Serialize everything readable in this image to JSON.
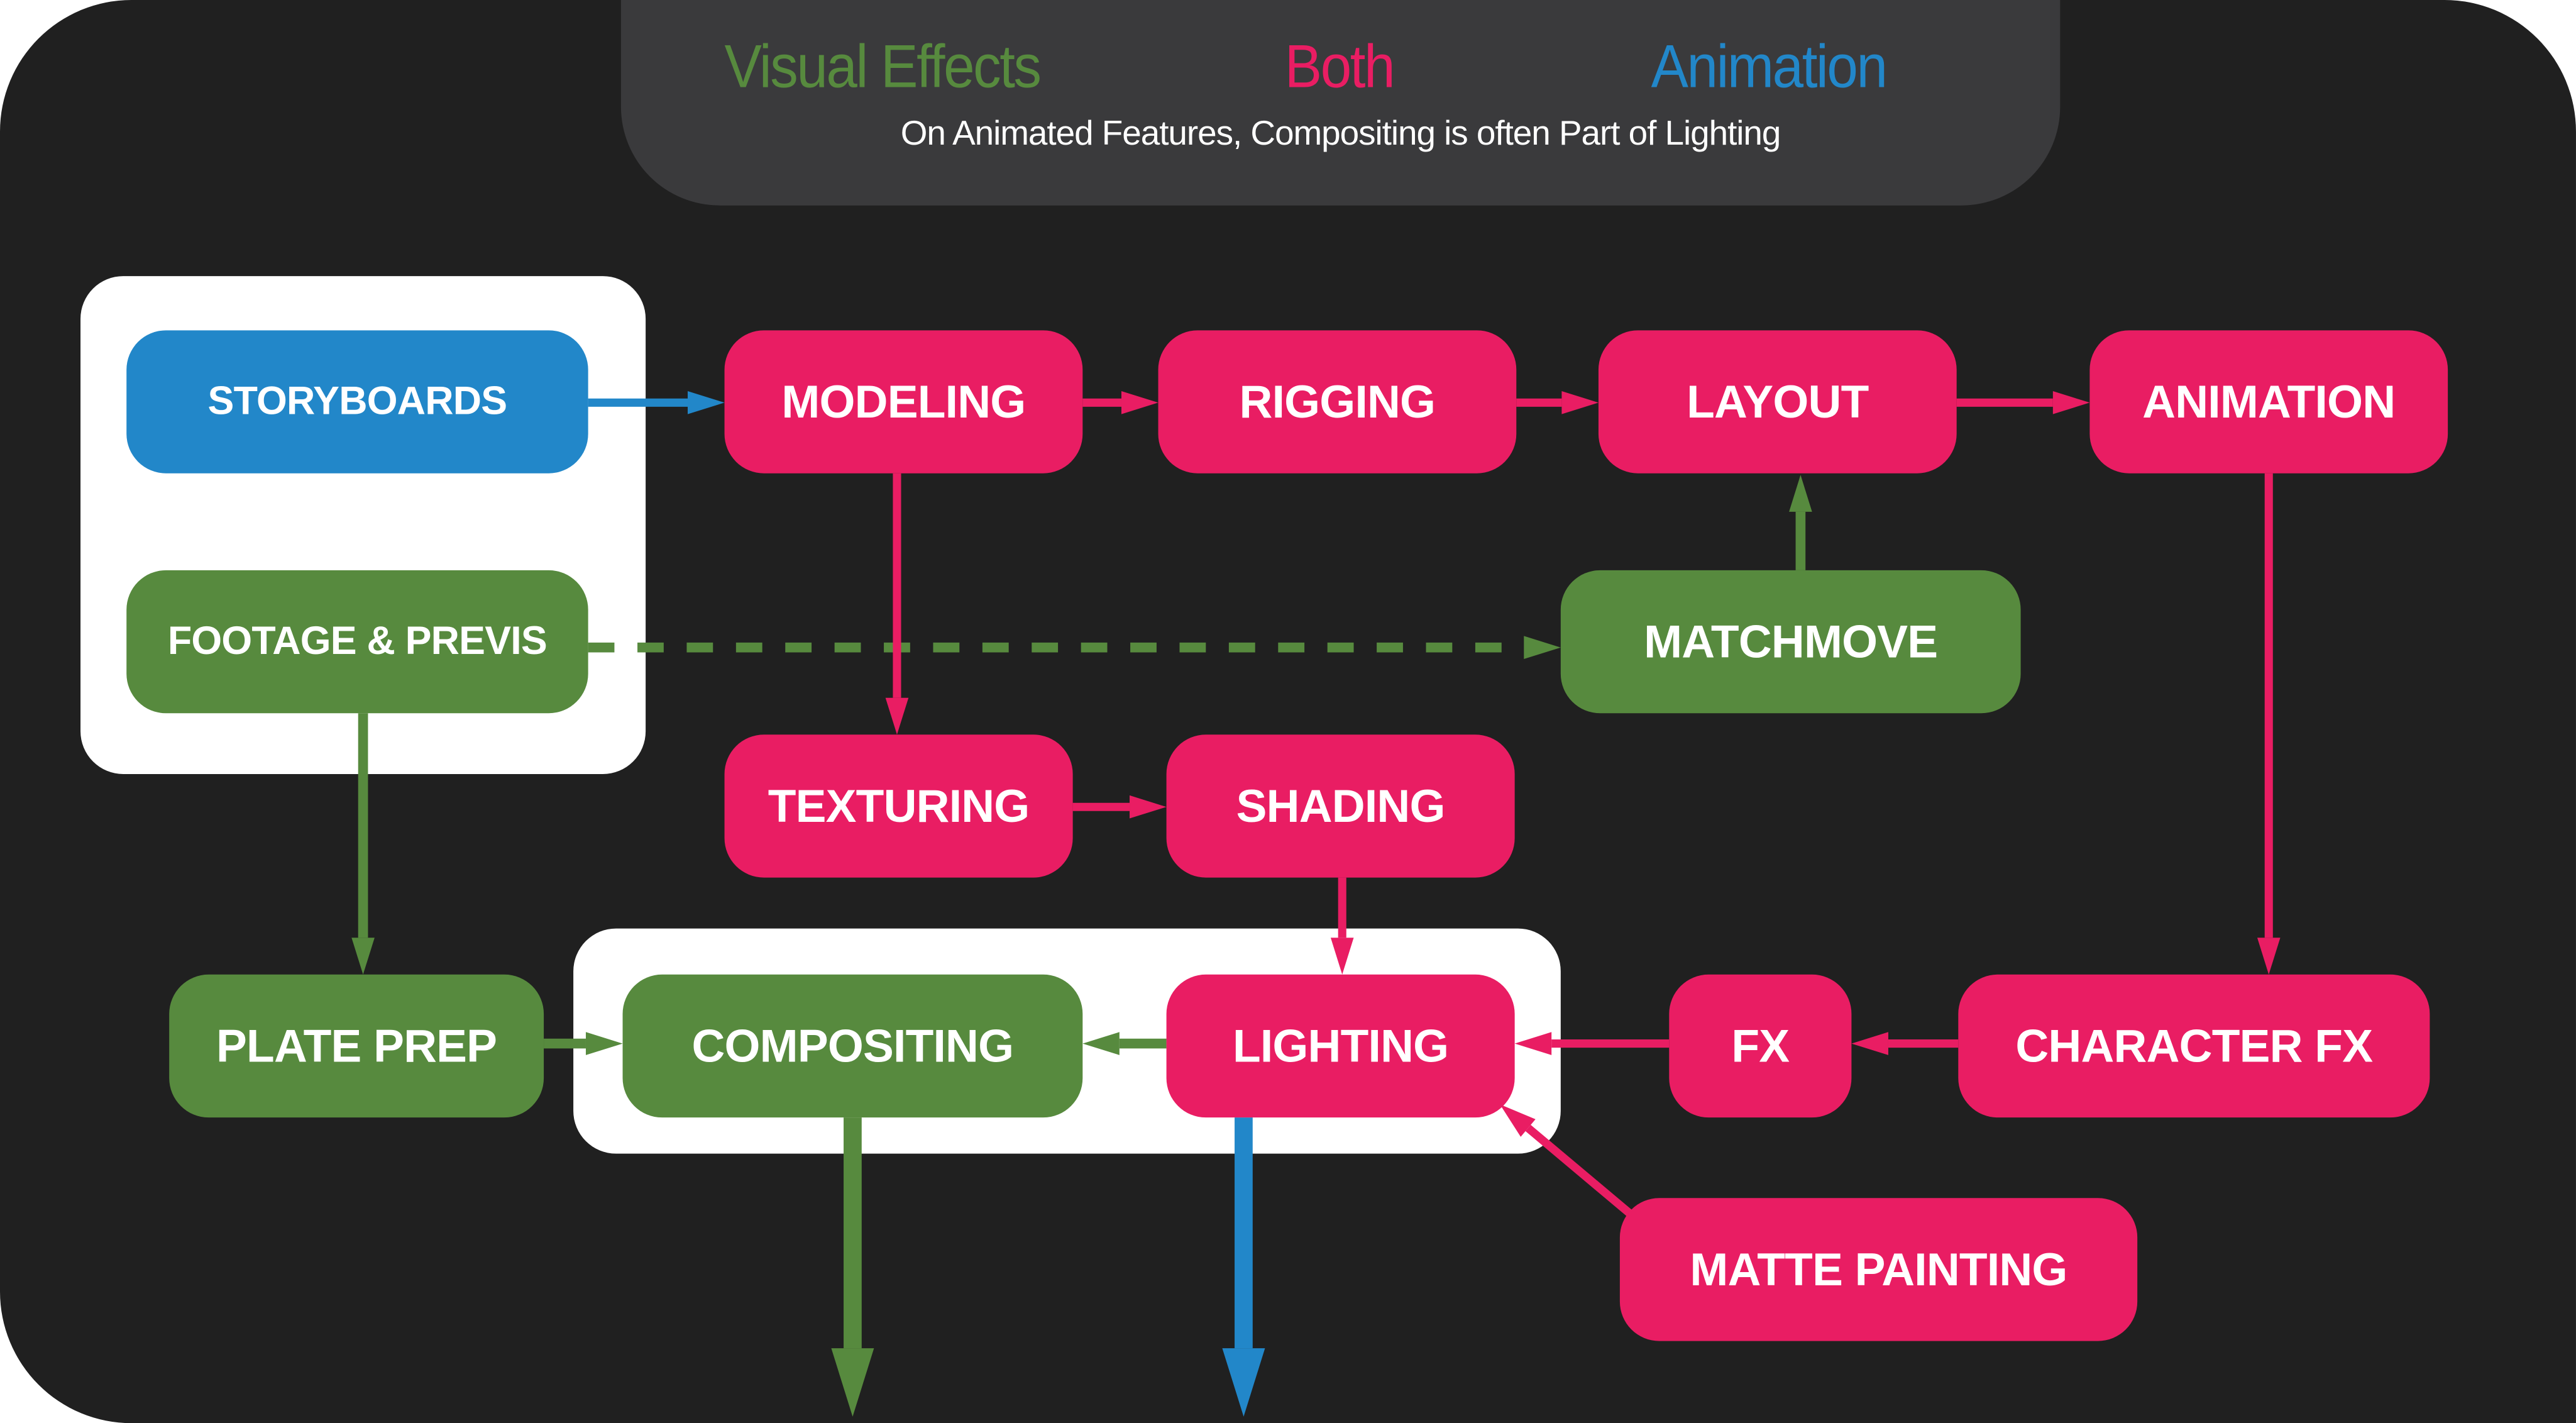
{
  "legend": {
    "categories": [
      {
        "label": "Visual Effects",
        "color": "#578a3e"
      },
      {
        "label": "Both",
        "color": "#e91d63"
      },
      {
        "label": "Animation",
        "color": "#2287c9"
      }
    ],
    "note": "On Animated Features, Compositing is often Part of Lighting"
  },
  "colors": {
    "vfx": "#578a3e",
    "both": "#e91d63",
    "animation": "#2287c9",
    "background": "#202020",
    "legend_panel": "#3a3a3c",
    "group_box": "#ffffff"
  },
  "nodes": {
    "storyboards": {
      "label": "STORYBOARDS",
      "category": "animation"
    },
    "footage_previs": {
      "label": "FOOTAGE & PREVIS",
      "category": "vfx"
    },
    "modeling": {
      "label": "MODELING",
      "category": "both"
    },
    "rigging": {
      "label": "RIGGING",
      "category": "both"
    },
    "layout": {
      "label": "LAYOUT",
      "category": "both"
    },
    "animation": {
      "label": "ANIMATION",
      "category": "both"
    },
    "matchmove": {
      "label": "MATCHMOVE",
      "category": "vfx"
    },
    "texturing": {
      "label": "TEXTURING",
      "category": "both"
    },
    "shading": {
      "label": "SHADING",
      "category": "both"
    },
    "plate_prep": {
      "label": "PLATE PREP",
      "category": "vfx"
    },
    "compositing": {
      "label": "COMPOSITING",
      "category": "vfx"
    },
    "lighting": {
      "label": "LIGHTING",
      "category": "both"
    },
    "fx": {
      "label": "FX",
      "category": "both"
    },
    "character_fx": {
      "label": "CHARACTER FX",
      "category": "both"
    },
    "matte_painting": {
      "label": "MATTE PAINTING",
      "category": "both"
    }
  },
  "edges": [
    {
      "from": "storyboards",
      "to": "modeling",
      "category": "animation",
      "style": "solid"
    },
    {
      "from": "modeling",
      "to": "rigging",
      "category": "both",
      "style": "solid"
    },
    {
      "from": "rigging",
      "to": "layout",
      "category": "both",
      "style": "solid"
    },
    {
      "from": "layout",
      "to": "animation",
      "category": "both",
      "style": "solid"
    },
    {
      "from": "matchmove",
      "to": "layout",
      "category": "vfx",
      "style": "solid"
    },
    {
      "from": "footage_previs",
      "to": "matchmove",
      "category": "vfx",
      "style": "dashed"
    },
    {
      "from": "modeling",
      "to": "texturing",
      "category": "both",
      "style": "solid"
    },
    {
      "from": "texturing",
      "to": "shading",
      "category": "both",
      "style": "solid"
    },
    {
      "from": "shading",
      "to": "lighting",
      "category": "both",
      "style": "solid"
    },
    {
      "from": "animation",
      "to": "character_fx",
      "category": "both",
      "style": "solid"
    },
    {
      "from": "character_fx",
      "to": "fx",
      "category": "both",
      "style": "solid"
    },
    {
      "from": "fx",
      "to": "lighting",
      "category": "both",
      "style": "solid"
    },
    {
      "from": "matte_painting",
      "to": "lighting",
      "category": "both",
      "style": "solid"
    },
    {
      "from": "lighting",
      "to": "compositing",
      "category": "vfx",
      "style": "solid"
    },
    {
      "from": "footage_previs",
      "to": "plate_prep",
      "category": "vfx",
      "style": "solid"
    },
    {
      "from": "plate_prep",
      "to": "compositing",
      "category": "vfx",
      "style": "solid"
    },
    {
      "from": "compositing",
      "to": "output",
      "category": "vfx",
      "style": "solid"
    },
    {
      "from": "lighting",
      "to": "output",
      "category": "animation",
      "style": "solid"
    }
  ]
}
